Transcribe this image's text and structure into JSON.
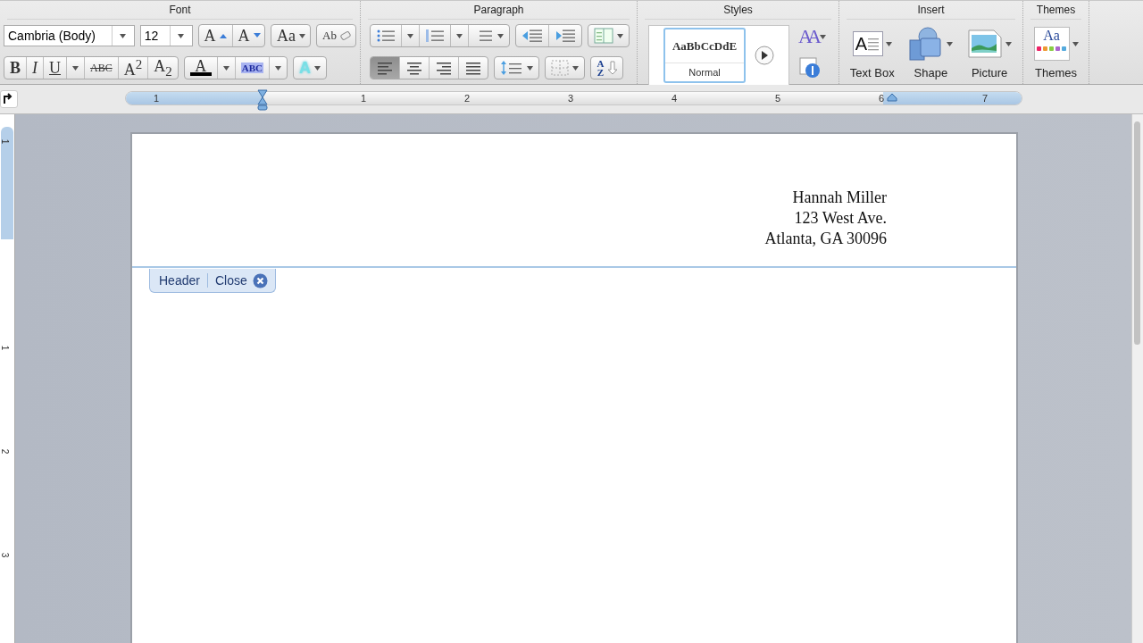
{
  "font_group": {
    "label": "Font",
    "font_name": "Cambria (Body)",
    "font_size": "12",
    "size_buttons": [
      {
        "glyph": "A",
        "kind": "grow"
      },
      {
        "glyph": "A",
        "kind": "shrink"
      }
    ],
    "change_case_glyph": "Aa",
    "clear_glyph": "Ab",
    "format_buttons": [
      {
        "glyph": "B",
        "kind": "bold",
        "dropdown": false
      },
      {
        "glyph": "I",
        "kind": "italic",
        "dropdown": false
      },
      {
        "glyph": "U",
        "kind": "underline",
        "dropdown": true
      },
      {
        "glyph": "ABC",
        "kind": "strike",
        "dropdown": false
      },
      {
        "glyph": "A$^{2}$",
        "kind": "script",
        "dropdown": false
      },
      {
        "glyph": "A$_{2}$",
        "kind": "script",
        "dropdown": false
      }
    ],
    "font_color_glyph": "A",
    "highlight_glyph": "ABC",
    "effects_glyph": "A"
  },
  "paragraph_group": {
    "label": "Paragraph",
    "align_buttons": [
      {
        "kind": "left",
        "selected": true
      },
      {
        "kind": "center",
        "selected": false
      },
      {
        "kind": "right",
        "selected": false
      },
      {
        "kind": "justify",
        "selected": false
      }
    ],
    "sort_glyph": "AZ"
  },
  "styles_group": {
    "label": "Styles",
    "preview": "AaBbCcDdE",
    "style_name": "Normal",
    "selected": true,
    "change_styles_glyph": "AA"
  },
  "insert_group": {
    "label": "Insert",
    "items": [
      {
        "label": "Text Box",
        "kind": "textbox",
        "glyph": "A"
      },
      {
        "label": "Shape",
        "kind": "shape"
      },
      {
        "label": "Picture",
        "kind": "picture"
      }
    ]
  },
  "themes_group": {
    "label": "Themes",
    "glyph": "Aa",
    "button_label": "Themes"
  },
  "ruler": {
    "labels": [
      "1",
      "1",
      "2",
      "3",
      "4",
      "5",
      "6",
      "7"
    ]
  },
  "vertical_ruler": {
    "labels": [
      "1",
      "1",
      "2",
      "3"
    ]
  },
  "header": {
    "lines": [
      "Hannah Miller",
      "123 West Ave.",
      "Atlanta, GA 30096"
    ]
  },
  "header_tab": {
    "label": "Header",
    "close_label": "Close"
  }
}
